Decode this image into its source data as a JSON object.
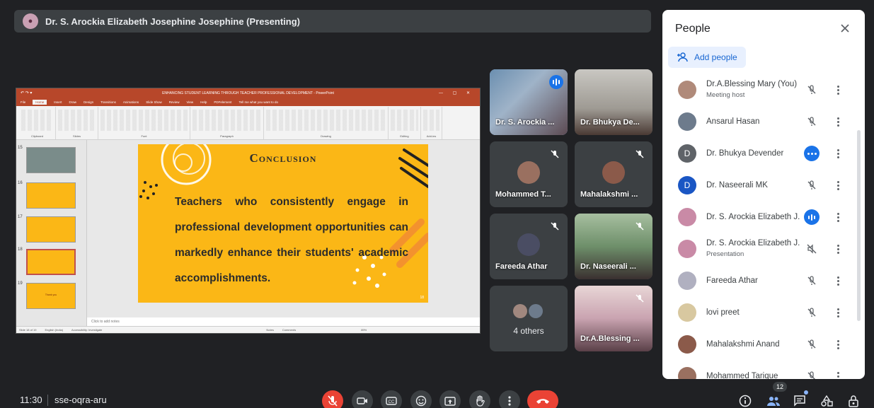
{
  "presenter": {
    "name": "Dr. S. Arockia Elizabeth Josephine Josephine (Presenting)"
  },
  "ppt": {
    "title": "ENHANCING STUDENT LEARNING THROUGH TEACHER PROFESSIONAL DEVELOPMENT - PowerPoint",
    "menu": [
      "File",
      "Home",
      "Insert",
      "Draw",
      "Design",
      "Transitions",
      "Animations",
      "Slide Show",
      "Review",
      "View",
      "Help",
      "PDFelement",
      "Tell me what you want to do"
    ],
    "ribbon_groups": [
      "Clipboard",
      "Slides",
      "Font",
      "Paragraph",
      "Drawing",
      "Editing",
      "Add-ins"
    ],
    "thumbnails": [
      {
        "num": "15",
        "caption": ""
      },
      {
        "num": "16",
        "caption": ""
      },
      {
        "num": "17",
        "caption": ""
      },
      {
        "num": "18",
        "caption": ""
      },
      {
        "num": "19",
        "caption": "Thank you"
      }
    ],
    "slide": {
      "title": "Conclusion",
      "body": "Teachers who consistently engage in professional development opportunities can markedly enhance their students' academic accomplishments.",
      "number": "18"
    },
    "notes_placeholder": "Click to add notes",
    "status": {
      "slide_info": "Slide 18 of 19",
      "language": "English (India)",
      "accessibility": "Accessibility: Investigate",
      "notes": "Notes",
      "comments": "Comments",
      "zoom": "89%"
    }
  },
  "tiles": [
    {
      "name": "Dr. S. Arockia ...",
      "kind": "video-speaking"
    },
    {
      "name": "Dr. Bhukya De...",
      "kind": "video"
    },
    {
      "name": "Mohammed T...",
      "kind": "avatar-muted"
    },
    {
      "name": "Mahalakshmi ...",
      "kind": "avatar-muted"
    },
    {
      "name": "Fareeda Athar",
      "kind": "avatar-muted"
    },
    {
      "name": "Dr. Naseerali ...",
      "kind": "video-muted"
    },
    {
      "name": "4 others",
      "kind": "others"
    },
    {
      "name": "Dr.A.Blessing ...",
      "kind": "video-muted"
    }
  ],
  "people_panel": {
    "title": "People",
    "add_label": "Add people",
    "participants": [
      {
        "name": "Dr.A.Blessing Mary (You)",
        "sub": "Meeting host",
        "avatar": "",
        "color": "#b08a7a",
        "mic": "muted"
      },
      {
        "name": "Ansarul Hasan",
        "sub": "",
        "avatar": "",
        "color": "#6d7b8c",
        "mic": "muted"
      },
      {
        "name": "Dr. Bhukya Devender",
        "sub": "",
        "avatar": "D",
        "color": "#5f6368",
        "mic": "dots"
      },
      {
        "name": "Dr. Naseerali MK",
        "sub": "",
        "avatar": "D",
        "color": "#1a56c4",
        "mic": "muted"
      },
      {
        "name": "Dr. S. Arockia Elizabeth J...",
        "sub": "",
        "avatar": "",
        "color": "#c98aa6",
        "mic": "speaking"
      },
      {
        "name": "Dr. S. Arockia Elizabeth J...",
        "sub": "Presentation",
        "avatar": "",
        "color": "#c98aa6",
        "mic": "muted"
      },
      {
        "name": "Fareeda Athar",
        "sub": "",
        "avatar": "",
        "color": "#b0b0c0",
        "mic": "muted"
      },
      {
        "name": "lovi preet",
        "sub": "",
        "avatar": "",
        "color": "#d8c8a0",
        "mic": "muted"
      },
      {
        "name": "Mahalakshmi Anand",
        "sub": "",
        "avatar": "",
        "color": "#8b5a4a",
        "mic": "muted"
      },
      {
        "name": "Mohammed Tarique",
        "sub": "",
        "avatar": "",
        "color": "#9a7060",
        "mic": "muted"
      }
    ]
  },
  "bottom": {
    "time": "11:30",
    "meeting_code": "sse-oqra-aru",
    "people_count": "12"
  }
}
